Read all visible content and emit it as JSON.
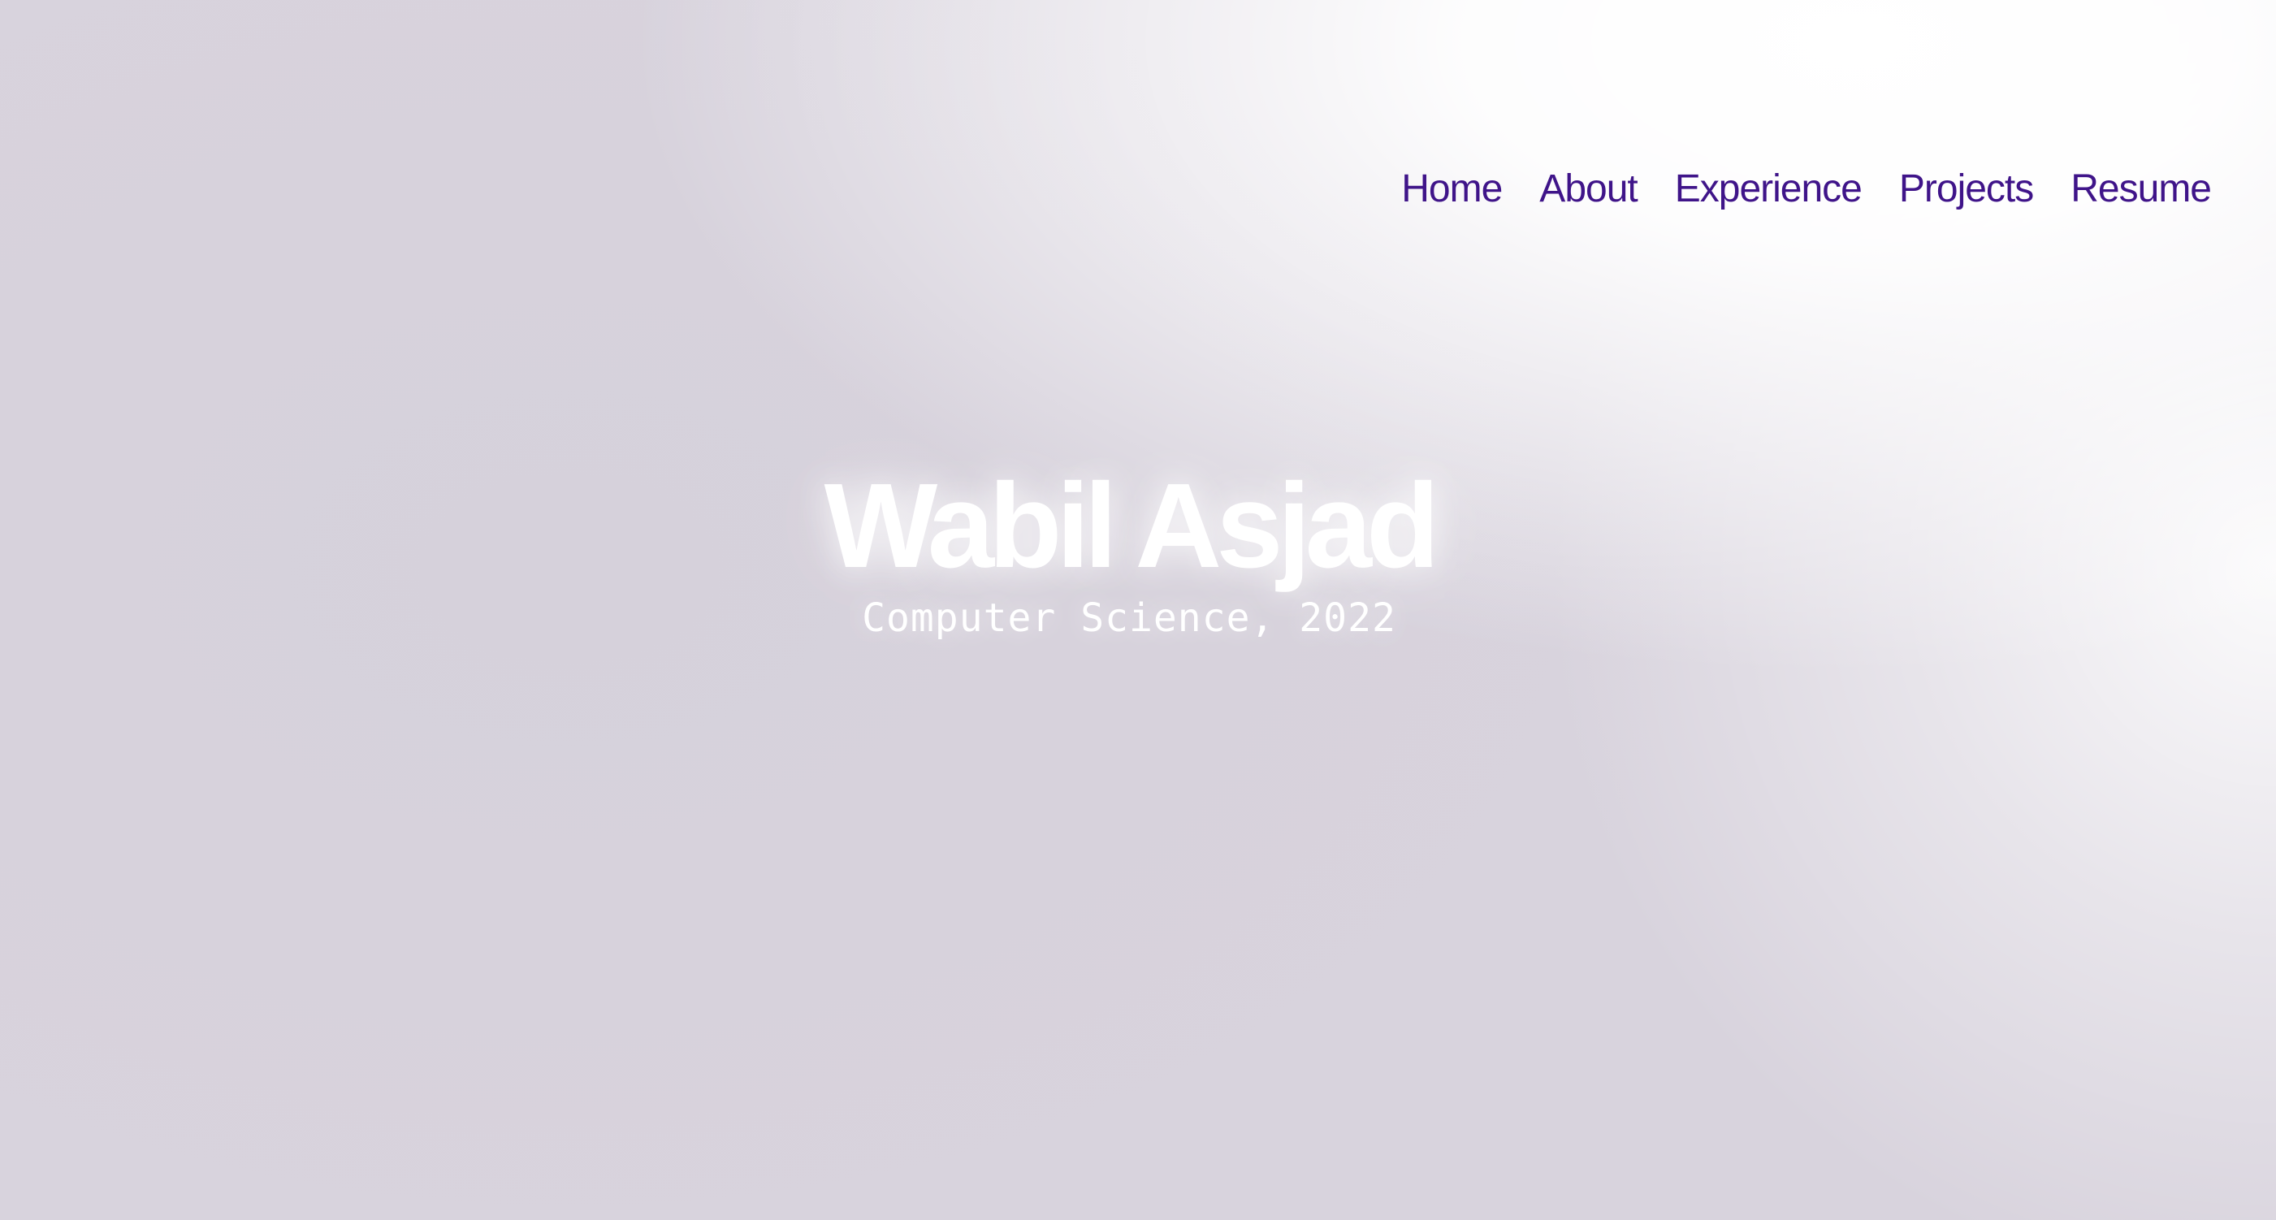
{
  "nav": {
    "items": [
      {
        "label": "Home"
      },
      {
        "label": "About"
      },
      {
        "label": "Experience"
      },
      {
        "label": "Projects"
      },
      {
        "label": "Resume"
      }
    ]
  },
  "hero": {
    "name": "Wabil Asjad",
    "subtitle": "Computer Science, 2022"
  },
  "colors": {
    "nav_link": "#3f1489",
    "background": "#d8d3dd",
    "hero_text": "#ffffff"
  }
}
